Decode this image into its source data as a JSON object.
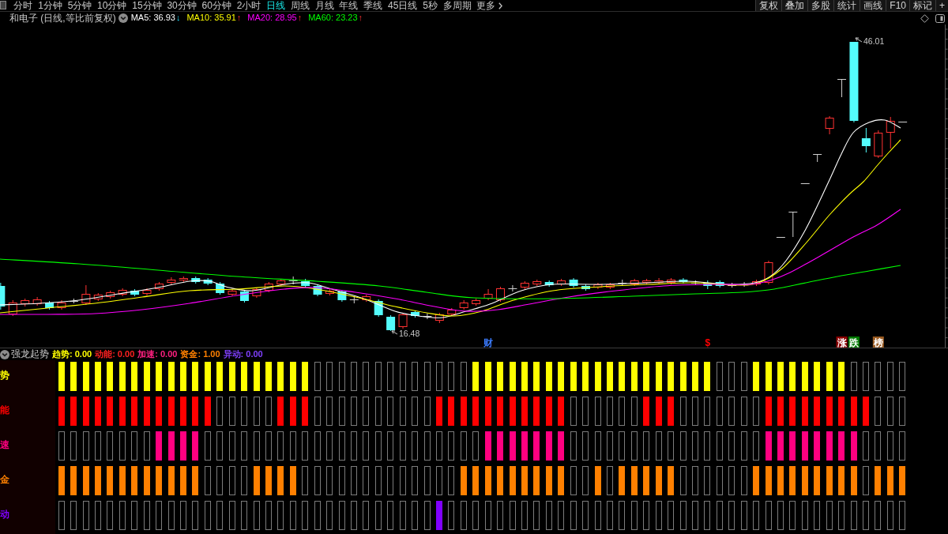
{
  "toolbar": {
    "periods": [
      {
        "label": "分时",
        "kind": "period",
        "selected": false
      },
      {
        "label": "1分钟",
        "kind": "period",
        "selected": false
      },
      {
        "label": "5分钟",
        "kind": "period",
        "selected": false
      },
      {
        "label": "10分钟",
        "kind": "period",
        "selected": false
      },
      {
        "label": "15分钟",
        "kind": "period",
        "selected": false
      },
      {
        "label": "30分钟",
        "kind": "period",
        "selected": false
      },
      {
        "label": "60分钟",
        "kind": "period",
        "selected": false
      },
      {
        "label": "2小时",
        "kind": "period",
        "selected": false
      },
      {
        "label": "日线",
        "kind": "period",
        "selected": true
      },
      {
        "label": "周线",
        "kind": "period",
        "selected": false
      },
      {
        "label": "月线",
        "kind": "period",
        "selected": false
      },
      {
        "label": "年线",
        "kind": "period",
        "selected": false
      },
      {
        "label": "季线",
        "kind": "period",
        "selected": false
      },
      {
        "label": "45日线",
        "kind": "period",
        "selected": false
      },
      {
        "label": "5秒",
        "kind": "period",
        "selected": false
      },
      {
        "label": "多周期",
        "kind": "period",
        "selected": false
      },
      {
        "label": "更多",
        "kind": "menu",
        "selected": false
      }
    ],
    "buttons": [
      "复权",
      "叠加",
      "多股",
      "统计",
      "画线",
      "F10",
      "标记",
      "+"
    ]
  },
  "chart_header": {
    "title": "和电子 (日线,等比前复权)",
    "indicators": [
      {
        "label": "MA5: 36.93",
        "arrow": "↓",
        "rising": false,
        "color": "#ffffff"
      },
      {
        "label": "MA10: 35.91",
        "arrow": "↑",
        "rising": true,
        "color": "#ffff00"
      },
      {
        "label": "MA20: 28.95",
        "arrow": "↑",
        "rising": true,
        "color": "#ff00ff"
      },
      {
        "label": "MA60: 23.23",
        "arrow": "↑",
        "rising": true,
        "color": "#00ff00"
      }
    ]
  },
  "price_chart": {
    "high_label": "46.01",
    "low_label": "16.48",
    "markers": [
      {
        "text": "财",
        "kind": "plain",
        "color": "#3b7bff"
      },
      {
        "text": "$",
        "kind": "plain",
        "color": "#ff0000"
      },
      {
        "text": "涨",
        "kind": "tag",
        "color": "#8b0000"
      },
      {
        "text": "跌",
        "kind": "tag",
        "color": "#007a00"
      },
      {
        "text": "榜",
        "kind": "tag",
        "color": "#9a5a20"
      }
    ]
  },
  "indicator_panel": {
    "title": "强龙起势",
    "legend": [
      {
        "text": "趋势: 0.00",
        "color": "#ffff00"
      },
      {
        "text": "动能: 0.00",
        "color": "#ff2020"
      },
      {
        "text": "加速: 0.00",
        "color": "#ff2080"
      },
      {
        "text": "资金: 1.00",
        "color": "#ff8000"
      },
      {
        "text": "异动: 0.00",
        "color": "#8040ff"
      }
    ],
    "rows": [
      {
        "label": "势",
        "color": "#ffff00",
        "filled": [
          true,
          true,
          true,
          true,
          true,
          true,
          true,
          true,
          true,
          true,
          true,
          true,
          true,
          true,
          true,
          true,
          true,
          true,
          true,
          true,
          true,
          false,
          false,
          false,
          false,
          false,
          false,
          false,
          false,
          false,
          false,
          false,
          false,
          false,
          true,
          true,
          true,
          true,
          true,
          true,
          true,
          true,
          true,
          true,
          true,
          true,
          true,
          true,
          true,
          true,
          true,
          true,
          true,
          true,
          false,
          false,
          false,
          true,
          true,
          true,
          true,
          true,
          true,
          true,
          true,
          false,
          false,
          false,
          false,
          false
        ]
      },
      {
        "label": "能",
        "color": "#ff0000",
        "filled": [
          true,
          true,
          true,
          true,
          true,
          true,
          true,
          true,
          true,
          true,
          true,
          true,
          true,
          false,
          false,
          false,
          false,
          false,
          true,
          true,
          true,
          false,
          false,
          false,
          false,
          false,
          false,
          false,
          false,
          false,
          false,
          true,
          true,
          true,
          true,
          true,
          true,
          true,
          true,
          true,
          true,
          true,
          false,
          false,
          false,
          false,
          false,
          false,
          true,
          true,
          true,
          false,
          false,
          false,
          false,
          false,
          false,
          false,
          true,
          true,
          true,
          true,
          true,
          true,
          true,
          true,
          true,
          false,
          false,
          false
        ]
      },
      {
        "label": "速",
        "color": "#ff0080",
        "filled": [
          false,
          false,
          false,
          false,
          false,
          false,
          false,
          false,
          true,
          true,
          true,
          true,
          false,
          false,
          false,
          false,
          false,
          false,
          false,
          false,
          false,
          false,
          false,
          false,
          false,
          false,
          false,
          false,
          false,
          false,
          false,
          false,
          false,
          false,
          false,
          true,
          true,
          true,
          true,
          true,
          true,
          true,
          false,
          false,
          false,
          false,
          false,
          false,
          false,
          false,
          false,
          false,
          false,
          false,
          false,
          false,
          false,
          false,
          true,
          true,
          true,
          true,
          true,
          true,
          true,
          true,
          false,
          false,
          false,
          false
        ]
      },
      {
        "label": "金",
        "color": "#ff8000",
        "filled": [
          true,
          true,
          true,
          true,
          true,
          true,
          true,
          true,
          true,
          true,
          true,
          true,
          false,
          false,
          false,
          false,
          true,
          true,
          true,
          true,
          false,
          false,
          false,
          false,
          false,
          false,
          false,
          false,
          false,
          false,
          false,
          false,
          false,
          true,
          true,
          true,
          true,
          true,
          true,
          true,
          true,
          true,
          false,
          false,
          true,
          false,
          true,
          true,
          true,
          true,
          true,
          false,
          false,
          false,
          false,
          false,
          false,
          true,
          true,
          true,
          true,
          true,
          true,
          true,
          true,
          true,
          false,
          true,
          true,
          true
        ]
      },
      {
        "label": "动",
        "color": "#8000ff",
        "filled": [
          false,
          false,
          false,
          false,
          false,
          false,
          false,
          false,
          false,
          false,
          false,
          false,
          false,
          false,
          false,
          false,
          false,
          false,
          false,
          false,
          false,
          false,
          false,
          false,
          false,
          false,
          false,
          false,
          false,
          false,
          false,
          true,
          false,
          false,
          false,
          false,
          false,
          false,
          false,
          false,
          false,
          false,
          false,
          false,
          false,
          false,
          false,
          false,
          false,
          false,
          false,
          false,
          false,
          false,
          false,
          false,
          false,
          false,
          false,
          false,
          false,
          false,
          false,
          false,
          false,
          false,
          false,
          false,
          false,
          false
        ]
      }
    ]
  }
}
